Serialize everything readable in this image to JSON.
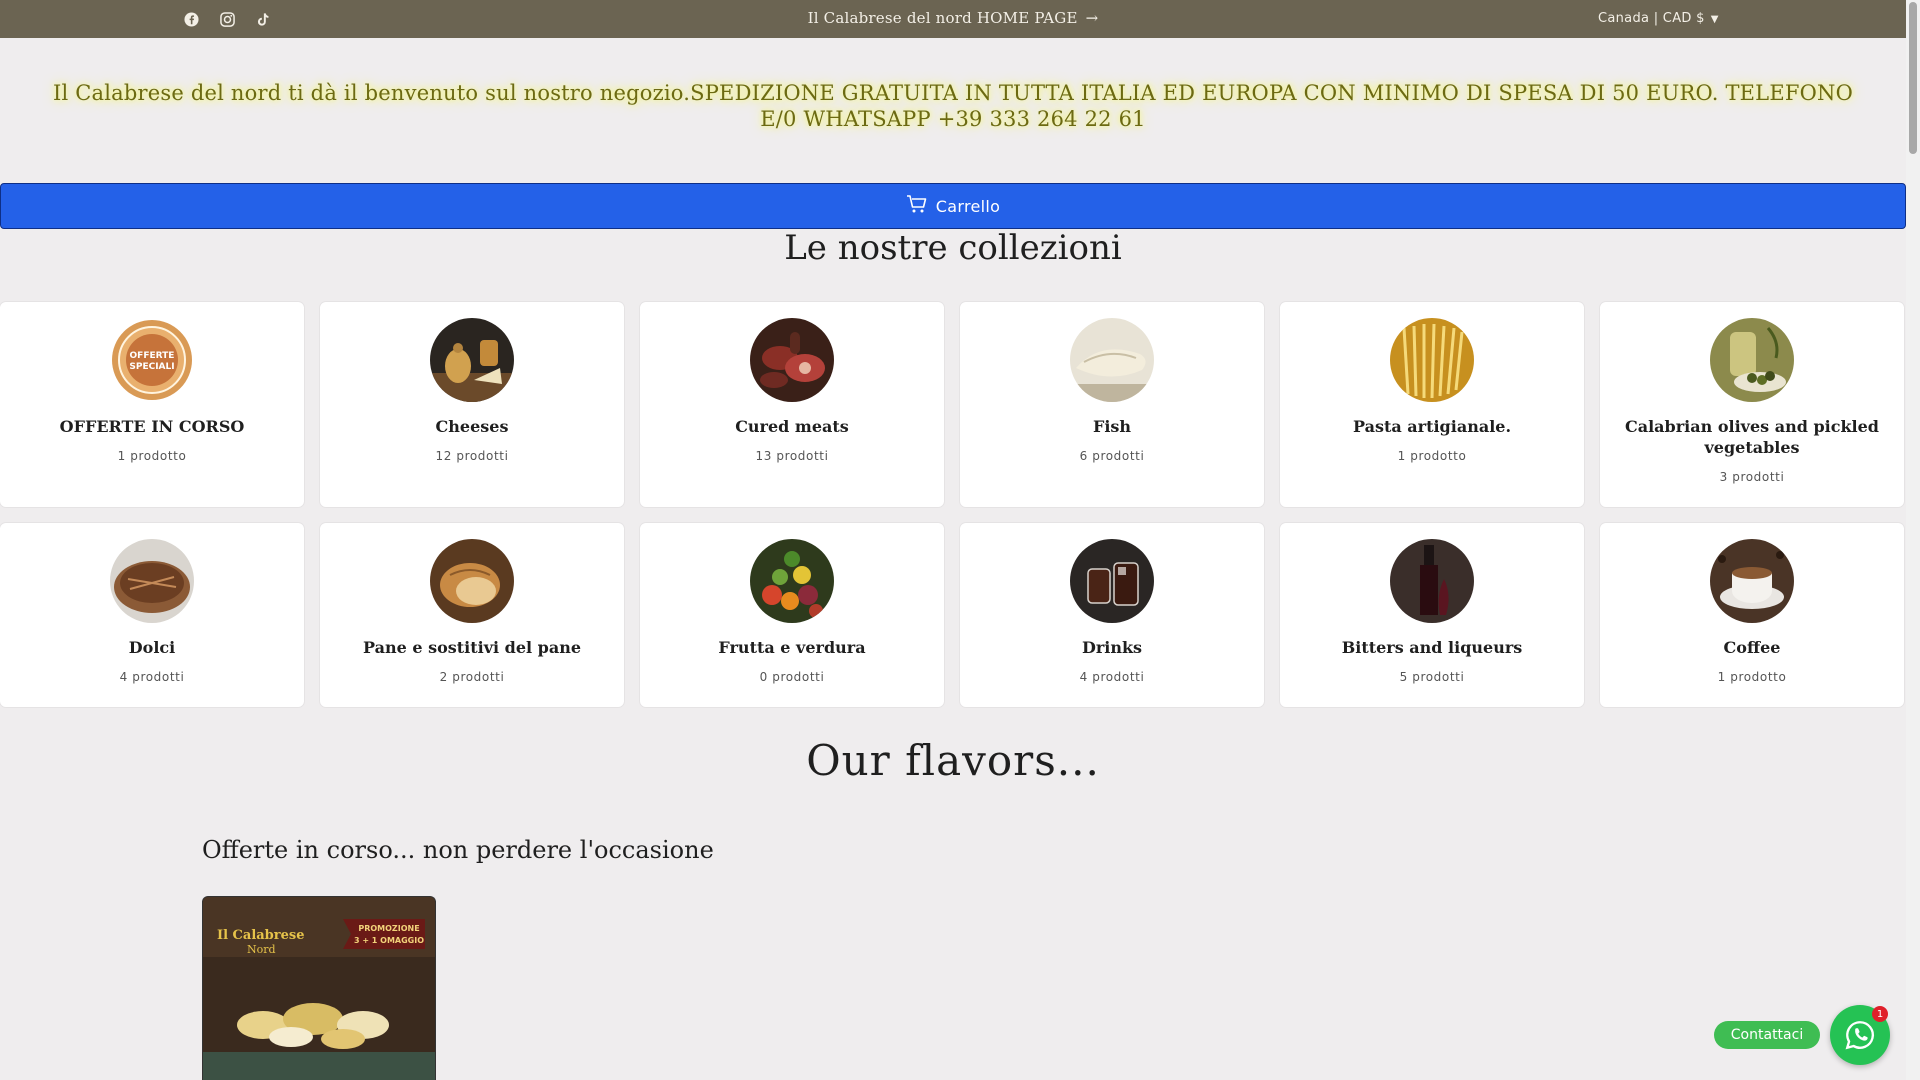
{
  "topbar": {
    "social_icons": [
      "facebook-icon",
      "instagram-icon",
      "tiktok-icon"
    ],
    "announcement": "Il Calabrese del nord HOME PAGE",
    "locale": "Canada | CAD $"
  },
  "welcome_text": "Il Calabrese del nord ti dà il benvenuto sul nostro negozio.SPEDIZIONE GRATUITA IN TUTTA ITALIA ED EUROPA CON MINIMO DI SPESA DI 50 EURO. TELEFONO E/0 WHATSAPP +39 333 264 22 61",
  "cart": {
    "label": "Carrello"
  },
  "collections": {
    "title": "Le nostre collezioni",
    "items": [
      {
        "name": "OFFERTE IN CORSO",
        "count": "1 prodotto",
        "image": "offerte-speciali-badge"
      },
      {
        "name": "Cheeses",
        "count": "12 prodotti",
        "image": "cheeses"
      },
      {
        "name": "Cured meats",
        "count": "13 prodotti",
        "image": "cured-meats"
      },
      {
        "name": "Fish",
        "count": "6 prodotti",
        "image": "fish"
      },
      {
        "name": "Pasta artigianale.",
        "count": "1 prodotto",
        "image": "pasta"
      },
      {
        "name": "Calabrian olives and pickled vegetables",
        "count": "3 prodotti",
        "image": "olives"
      },
      {
        "name": "Dolci",
        "count": "4 prodotti",
        "image": "dolci"
      },
      {
        "name": "Pane e sostitivi del pane",
        "count": "2 prodotti",
        "image": "bread"
      },
      {
        "name": "Frutta e verdura",
        "count": "0 prodotti",
        "image": "fruit-vegetables"
      },
      {
        "name": "Drinks",
        "count": "4 prodotti",
        "image": "drinks"
      },
      {
        "name": "Bitters and liqueurs",
        "count": "5 prodotti",
        "image": "liqueurs"
      },
      {
        "name": "Coffee",
        "count": "1 prodotto",
        "image": "coffee"
      }
    ]
  },
  "flavors": {
    "title": "Our flavors...",
    "subtitle": "Offerte in corso... non perdere l'occasione",
    "product": {
      "logo_text_1": "Il Calabrese",
      "logo_text_2": "Nord",
      "promo_1": "PROMOZIONE",
      "promo_2": "3 + 1 OMAGGIO"
    }
  },
  "contact": {
    "label": "Contattaci",
    "badge": "1"
  },
  "colors": {
    "topbar": "#6b6452",
    "cart_button": "#2461e8",
    "welcome_text": "#6c6a12",
    "whatsapp": "#25c254"
  }
}
